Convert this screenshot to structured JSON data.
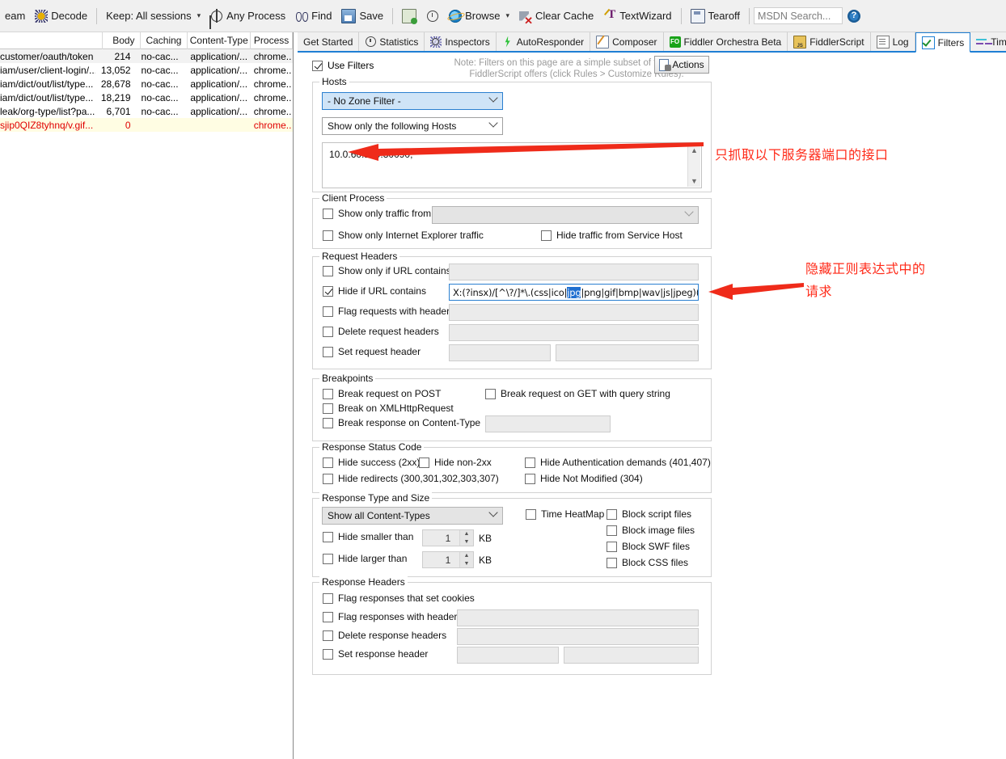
{
  "toolbar": {
    "items": [
      {
        "label": "eam",
        "icon": "stream-icon"
      },
      {
        "label": "Decode",
        "icon": "decode-icon"
      },
      {
        "label": "Keep: All sessions",
        "icon": "none",
        "caret": true
      },
      {
        "label": "Any Process",
        "icon": "target-icon"
      },
      {
        "label": "Find",
        "icon": "binoculars-icon"
      },
      {
        "label": "Save",
        "icon": "save-icon"
      },
      {
        "label": "",
        "icon": "clipboard-icon"
      },
      {
        "label": "",
        "icon": "clock-icon"
      },
      {
        "label": "Browse",
        "icon": "ie-icon",
        "caret": true
      },
      {
        "label": "Clear Cache",
        "icon": "clear-cache-icon"
      },
      {
        "label": "TextWizard",
        "icon": "text-wizard-icon"
      },
      {
        "label": "Tearoff",
        "icon": "tearoff-icon"
      }
    ],
    "msdn_search_placeholder": "MSDN Search...",
    "help_icon": "help-icon"
  },
  "tabs": [
    {
      "label": "Get Started",
      "icon": "none",
      "active": false
    },
    {
      "label": "Statistics",
      "icon": "statistics-icon",
      "active": false
    },
    {
      "label": "Inspectors",
      "icon": "inspectors-icon",
      "active": false
    },
    {
      "label": "AutoResponder",
      "icon": "bolt-icon",
      "active": false
    },
    {
      "label": "Composer",
      "icon": "composer-icon",
      "active": false
    },
    {
      "label": "Fiddler Orchestra Beta",
      "icon": "fo-icon",
      "active": false
    },
    {
      "label": "FiddlerScript",
      "icon": "fiddlerscript-icon",
      "active": false
    },
    {
      "label": "Log",
      "icon": "log-icon",
      "active": false
    },
    {
      "label": "Filters",
      "icon": "filters-check-icon",
      "active": true
    },
    {
      "label": "Timeline",
      "icon": "timeline-icon",
      "active": false
    }
  ],
  "sessions": {
    "columns": [
      "",
      "Body",
      "Caching",
      "Content-Type",
      "Process"
    ],
    "rows": [
      {
        "url": "customer/oauth/token",
        "body": "214",
        "caching": "no-cac...",
        "content_type": "application/...",
        "process": "chrome..",
        "style": "alt"
      },
      {
        "url": "iam/user/client-login/...",
        "body": "13,052",
        "caching": "no-cac...",
        "content_type": "application/...",
        "process": "chrome..",
        "style": "plain"
      },
      {
        "url": "iam/dict/out/list/type...",
        "body": "28,678",
        "caching": "no-cac...",
        "content_type": "application/...",
        "process": "chrome..",
        "style": "plain"
      },
      {
        "url": "iam/dict/out/list/type...",
        "body": "18,219",
        "caching": "no-cac...",
        "content_type": "application/...",
        "process": "chrome..",
        "style": "plain"
      },
      {
        "url": "leak/org-type/list?pa...",
        "body": "6,701",
        "caching": "no-cac...",
        "content_type": "application/...",
        "process": "chrome..",
        "style": "plain"
      },
      {
        "url": "sjip0QIZ8tyhnq/v.gif...",
        "body": "0",
        "caching": "",
        "content_type": "",
        "process": "chrome..",
        "style": "hl"
      }
    ]
  },
  "filters": {
    "use_filters_label": "Use Filters",
    "use_filters_checked": true,
    "note_line1": "Note: Filters on this page are a simple subset of the filtering",
    "note_line2": "FiddlerScript offers (click Rules > Customize Rules).",
    "actions_label": "Actions",
    "hosts": {
      "group_label": "Hosts",
      "zone_filter": "- No Zone Filter -",
      "host_mode": "Show only the following Hosts",
      "host_list": "10.0.60.160:30090;"
    },
    "client_process": {
      "group_label": "Client Process",
      "show_only_traffic_from": {
        "label": "Show only traffic from",
        "checked": false,
        "value": ""
      },
      "show_only_ie": {
        "label": "Show only Internet Explorer traffic",
        "checked": false
      },
      "hide_service_host": {
        "label": "Hide traffic from Service Host",
        "checked": false
      }
    },
    "request_headers": {
      "group_label": "Request Headers",
      "show_only_url_contains": {
        "label": "Show only if URL contains",
        "checked": false,
        "value": ""
      },
      "hide_if_url_contains": {
        "label": "Hide if URL contains",
        "checked": true,
        "value_prefix": "X:(?insx)/[^\\?/]*\\.(css|ico|",
        "value_selected": "jpg",
        "value_suffix": "|png|gif|bmp|wav|js|jpeg)(\\?.*)?$"
      },
      "flag_requests_with_headers": {
        "label": "Flag requests with headers",
        "checked": false,
        "value": ""
      },
      "delete_request_headers": {
        "label": "Delete request headers",
        "checked": false,
        "value": ""
      },
      "set_request_header": {
        "label": "Set request header",
        "checked": false,
        "value1": "",
        "value2": ""
      }
    },
    "breakpoints": {
      "group_label": "Breakpoints",
      "break_request_post": {
        "label": "Break request on POST",
        "checked": false
      },
      "break_xmlhttprequest": {
        "label": "Break on XMLHttpRequest",
        "checked": false
      },
      "break_response_content_type": {
        "label": "Break response on Content-Type",
        "checked": false,
        "value": ""
      },
      "break_request_get_query": {
        "label": "Break request on GET with query string",
        "checked": false
      }
    },
    "response_status_code": {
      "group_label": "Response Status Code",
      "hide_success": {
        "label": "Hide success (2xx)",
        "checked": false
      },
      "hide_non_2xx": {
        "label": "Hide non-2xx",
        "checked": false
      },
      "hide_auth_demands": {
        "label": "Hide Authentication demands (401,407)",
        "checked": false
      },
      "hide_redirects": {
        "label": "Hide redirects (300,301,302,303,307)",
        "checked": false
      },
      "hide_not_modified": {
        "label": "Hide Not Modified (304)",
        "checked": false
      }
    },
    "response_type_size": {
      "group_label": "Response Type and Size",
      "content_types": "Show all Content-Types",
      "hide_smaller_than": {
        "label": "Hide smaller than",
        "checked": false,
        "value": "1",
        "unit": "KB"
      },
      "hide_larger_than": {
        "label": "Hide larger than",
        "checked": false,
        "value": "1",
        "unit": "KB"
      },
      "time_heatmap": {
        "label": "Time HeatMap",
        "checked": false
      },
      "block_script_files": {
        "label": "Block script files",
        "checked": false
      },
      "block_image_files": {
        "label": "Block image files",
        "checked": false
      },
      "block_swf_files": {
        "label": "Block SWF files",
        "checked": false
      },
      "block_css_files": {
        "label": "Block CSS files",
        "checked": false
      }
    },
    "response_headers": {
      "group_label": "Response Headers",
      "flag_responses_cookies": {
        "label": "Flag responses that set cookies",
        "checked": false
      },
      "flag_responses_headers": {
        "label": "Flag responses with headers",
        "checked": false,
        "value": ""
      },
      "delete_response_headers": {
        "label": "Delete response headers",
        "checked": false,
        "value": ""
      },
      "set_response_header": {
        "label": "Set response header",
        "checked": false,
        "value1": "",
        "value2": ""
      }
    }
  },
  "annotations": {
    "color": "#ff2a18",
    "note1": "只抓取以下服务器端口的接口",
    "note2_line1": "隐藏正则表达式中的",
    "note2_line2": "请求"
  }
}
